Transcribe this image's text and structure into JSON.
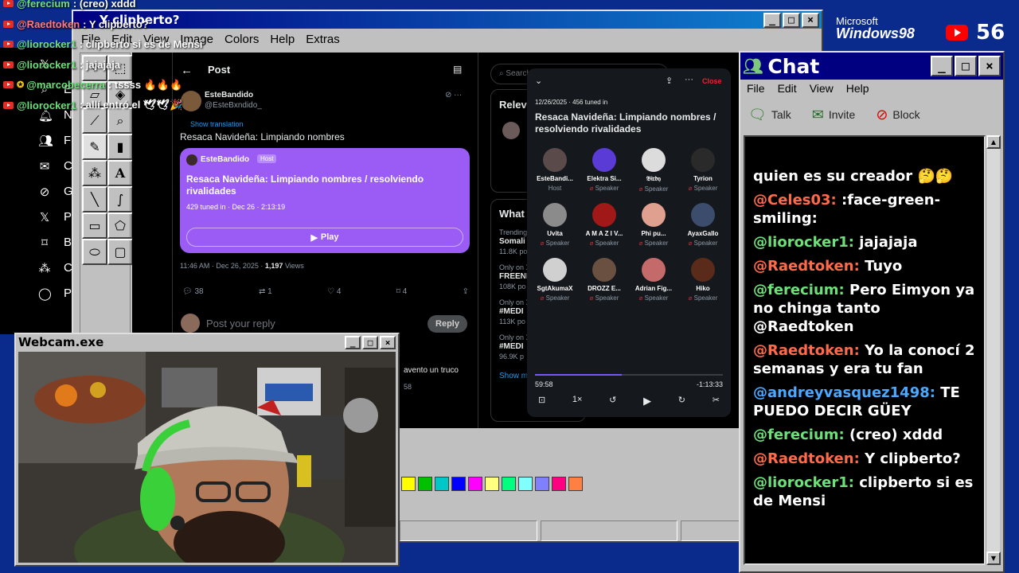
{
  "stream_chat": [
    {
      "user": "@ferecium",
      "text": ": (creo) xddd",
      "color": "#6de07a",
      "star": false
    },
    {
      "user": "@Raedtoken",
      "text": ": Y clipberto?",
      "color": "#ff7a7a",
      "star": false
    },
    {
      "user": "@liorocker1",
      "text": ": clipberto si es de Mensi",
      "color": "#6de07a",
      "star": false
    },
    {
      "user": "@liorocker1",
      "text": ": jajajaja",
      "color": "#6de07a",
      "star": false
    },
    {
      "user": "@marcobecerra",
      "text": ": tssss 🔥🔥🔥",
      "color": "#6de07a",
      "star": true
    },
    {
      "user": "@liorocker1",
      "text": ": allí entró el 🕊🕊🎉",
      "color": "#6de07a",
      "star": false
    }
  ],
  "paint": {
    "title": "Y clipberto?",
    "menu": [
      "File",
      "Edit",
      "View",
      "Image",
      "Colors",
      "Help",
      "Extras"
    ],
    "tools": [
      "free-select",
      "rect-select",
      "eraser",
      "fill",
      "eyedropper",
      "zoom",
      "pencil",
      "brush",
      "airbrush",
      "text",
      "line",
      "curve",
      "rectangle",
      "polygon",
      "ellipse",
      "rounded-rect"
    ],
    "palette": [
      "#ffff00",
      "#00c000",
      "#00c8c8",
      "#0000ff",
      "#ff00ff",
      "#ffff80",
      "#00ff80",
      "#80ffff",
      "#8080ff",
      "#ff0080",
      "#ff8040"
    ]
  },
  "x": {
    "nav": [
      {
        "icon": "x-logo-icon",
        "label": ""
      },
      {
        "icon": "search-icon",
        "label": "E"
      },
      {
        "icon": "bell-icon",
        "label": "N"
      },
      {
        "icon": "people-icon",
        "label": "F"
      },
      {
        "icon": "mail-icon",
        "label": "C"
      },
      {
        "icon": "grok-icon",
        "label": "G"
      },
      {
        "icon": "x-icon",
        "label": "P"
      },
      {
        "icon": "bookmark-icon",
        "label": "B"
      },
      {
        "icon": "communities-icon",
        "label": "C"
      },
      {
        "icon": "profile-icon",
        "label": "P"
      }
    ],
    "post": {
      "header": "Post",
      "author_name": "EsteBandido",
      "author_handle": "@EsteBxndido_",
      "show_translation": "Show translation",
      "text": "Resaca Navideña: Limpiando nombres",
      "space": {
        "host_name": "EsteBandido",
        "host_badge": "Host",
        "title": "Resaca Navideña: Limpiando nombres / resolviendo rivalidades",
        "meta": "429 tuned in · Dec 26 · 2:13:19",
        "play_label": "Play"
      },
      "timestamp": "11:46 AM · Dec 26, 2025 · ",
      "views_count": "1,197",
      "views_label": " Views",
      "actions": {
        "replies": "38",
        "reposts": "1",
        "likes": "4",
        "bookmarks": "4"
      },
      "reply_placeholder": "Post your reply",
      "reply_button": "Reply",
      "next_reply_text": "avento un truco",
      "next_reply_count": "58"
    },
    "right": {
      "search_placeholder": "Search",
      "relevant_title": "Relev",
      "whats_title": "What",
      "trends": [
        {
          "meta": "Trending",
          "name": "Somali",
          "count": "11.8K po"
        },
        {
          "meta": "Only on X",
          "name": "FREENE",
          "count": "108K po"
        },
        {
          "meta": "Only on X",
          "name": "#MEDI",
          "count": "113K po"
        },
        {
          "meta": "Only on X",
          "name": "#MEDI",
          "count": "96.9K p"
        }
      ],
      "show_more": "Show m"
    },
    "spaces_panel": {
      "close_label": "Close",
      "date_meta": "12/26/2025 · 456 tuned in",
      "title": "Resaca Navideña: Limpiando nombres / resolviendo rivalidades",
      "speakers": [
        {
          "name": "EsteBandi...",
          "role": "Host",
          "color": "#5a4a4a"
        },
        {
          "name": "Elektra Si...",
          "role": "Speaker",
          "color": "#5b3bd6"
        },
        {
          "name": "𝔅𝔦𝔯𝔡𝔶",
          "role": "Speaker",
          "color": "#dcdcdc"
        },
        {
          "name": "Tyrion",
          "role": "Speaker",
          "color": "#2a2a2a"
        },
        {
          "name": "Uvita",
          "role": "Speaker",
          "color": "#8b8b8b"
        },
        {
          "name": "A M A Z I V...",
          "role": "Speaker",
          "color": "#a11818"
        },
        {
          "name": "Phi pu...",
          "role": "Speaker",
          "color": "#e0a090"
        },
        {
          "name": "AyaxGallo",
          "role": "Speaker",
          "color": "#3c4c6c"
        },
        {
          "name": "SgtAkumaX",
          "role": "Speaker",
          "color": "#d0d0d0"
        },
        {
          "name": "DROZZ E...",
          "role": "Speaker",
          "color": "#6a5040"
        },
        {
          "name": "Adrian Fig...",
          "role": "Speaker",
          "color": "#c46a6a"
        },
        {
          "name": "Hiko",
          "role": "Speaker",
          "color": "#5a2a1a"
        }
      ],
      "elapsed": "59:58",
      "remaining": "-1:13:33",
      "progress": 0.46,
      "speed": "1×"
    }
  },
  "chat_window": {
    "title": "Chat",
    "menu": [
      "File",
      "Edit",
      "View",
      "Help"
    ],
    "tools": [
      {
        "label": "Talk",
        "icon": "talk-icon"
      },
      {
        "label": "Invite",
        "icon": "invite-icon"
      },
      {
        "label": "Block",
        "icon": "block-icon"
      }
    ],
    "messages": [
      {
        "user": "",
        "text": "quien es su creador 🤔🤔",
        "color": "#ffffff"
      },
      {
        "user": "@Celes03:",
        "text": ":face-green-smiling:",
        "color": "#ff6a4a"
      },
      {
        "user": "@liorocker1:",
        "text": "jajajaja",
        "color": "#6de07a"
      },
      {
        "user": "@Raedtoken:",
        "text": "Tuyo",
        "color": "#ff6a4a"
      },
      {
        "user": "@ferecium:",
        "text": "Pero Eimyon ya no chinga tanto @Raedtoken",
        "color": "#6de07a"
      },
      {
        "user": "@Raedtoken:",
        "text": "Yo la conocí 2 semanas y era tu fan",
        "color": "#ff6a4a"
      },
      {
        "user": "@andreyvasquez1498:",
        "text": "TE PUEDO DECIR GÜEY",
        "color": "#4aa8ff"
      },
      {
        "user": "@ferecium:",
        "text": "(creo) xddd",
        "color": "#6de07a"
      },
      {
        "user": "@Raedtoken:",
        "text": "Y clipberto?",
        "color": "#ff6a4a"
      },
      {
        "user": "@liorocker1:",
        "text": "clipberto si es de Mensi",
        "color": "#6de07a"
      }
    ]
  },
  "webcam": {
    "title": "Webcam.exe"
  },
  "brand": {
    "microsoft": "Microsoft",
    "windows": "Windows98"
  },
  "viewers": {
    "count": "56"
  }
}
